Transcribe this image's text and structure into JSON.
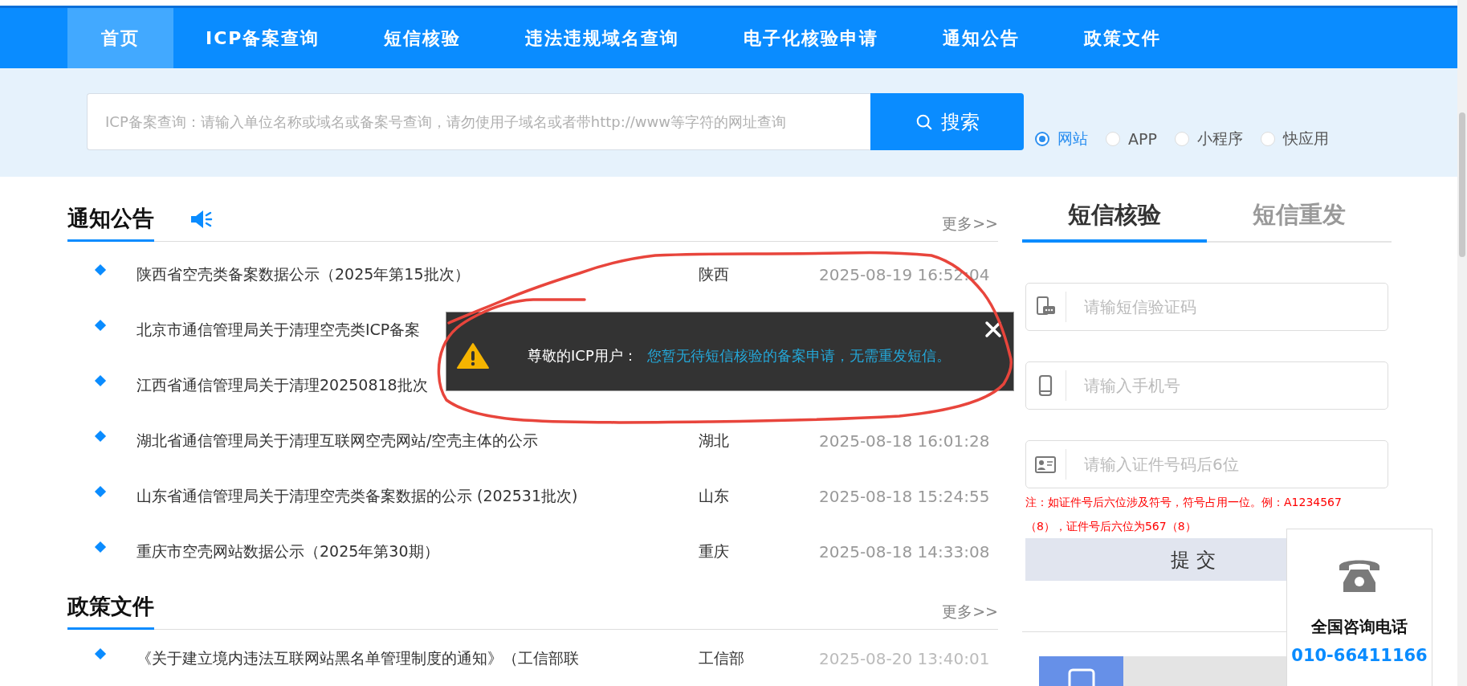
{
  "nav": {
    "items": [
      {
        "label": "首页",
        "selected": true
      },
      {
        "label": "ICP备案查询",
        "selected": false
      },
      {
        "label": "短信核验",
        "selected": false
      },
      {
        "label": "违法违规域名查询",
        "selected": false
      },
      {
        "label": "电子化核验申请",
        "selected": false
      },
      {
        "label": "通知公告",
        "selected": false
      },
      {
        "label": "政策文件",
        "selected": false
      }
    ]
  },
  "search": {
    "placeholder": "ICP备案查询：请输入单位名称或域名或备案号查询，请勿使用子域名或者带http://www等字符的网址查询",
    "button": "搜索",
    "types": [
      {
        "label": "网站",
        "selected": true
      },
      {
        "label": "APP",
        "selected": false
      },
      {
        "label": "小程序",
        "selected": false
      },
      {
        "label": "快应用",
        "selected": false
      }
    ]
  },
  "notices": {
    "title": "通知公告",
    "more": "更多>>",
    "items": [
      {
        "title": "陕西省空壳类备案数据公示（2025年第15批次）",
        "region": "陕西",
        "date": "2025-08-19 16:52:04"
      },
      {
        "title": "北京市通信管理局关于清理空壳类ICP备案"
      },
      {
        "title": "江西省通信管理局关于清理20250818批次"
      },
      {
        "title": "湖北省通信管理局关于清理互联网空壳网站/空壳主体的公示",
        "region": "湖北",
        "date": "2025-08-18 16:01:28"
      },
      {
        "title": "山东省通信管理局关于清理空壳类备案数据的公示 (202531批次)",
        "region": "山东",
        "date": "2025-08-18 15:24:55"
      },
      {
        "title": "重庆市空壳网站数据公示（2025年第30期）",
        "region": "重庆",
        "date": "2025-08-18 14:33:08"
      }
    ]
  },
  "policies": {
    "title": "政策文件",
    "more": "更多>>",
    "items": [
      {
        "title": "《关于建立境内违法互联网站黑名单管理制度的通知》（工信部联",
        "region": "工信部",
        "date": "2025-08-20 13:40:01"
      }
    ]
  },
  "sms": {
    "tabs": [
      {
        "label": "短信核验",
        "selected": true
      },
      {
        "label": "短信重发",
        "selected": false
      }
    ],
    "fields": [
      {
        "kind": "code",
        "placeholder": "请输短信验证码"
      },
      {
        "kind": "phone",
        "placeholder": "请输入手机号"
      },
      {
        "kind": "id",
        "placeholder": "请输入证件号码后6位"
      }
    ],
    "note": "注：如证件号后六位涉及符号，符号占用一位。例：A1234567（8），证件号后六位为567（8）",
    "submit": "提 交"
  },
  "hotline": {
    "title": "全国咨询电话",
    "number": "010-66411166"
  },
  "popup": {
    "greeting": "尊敬的ICP用户：",
    "message": "您暂无待短信核验的备案申请，无需重发短信。"
  }
}
